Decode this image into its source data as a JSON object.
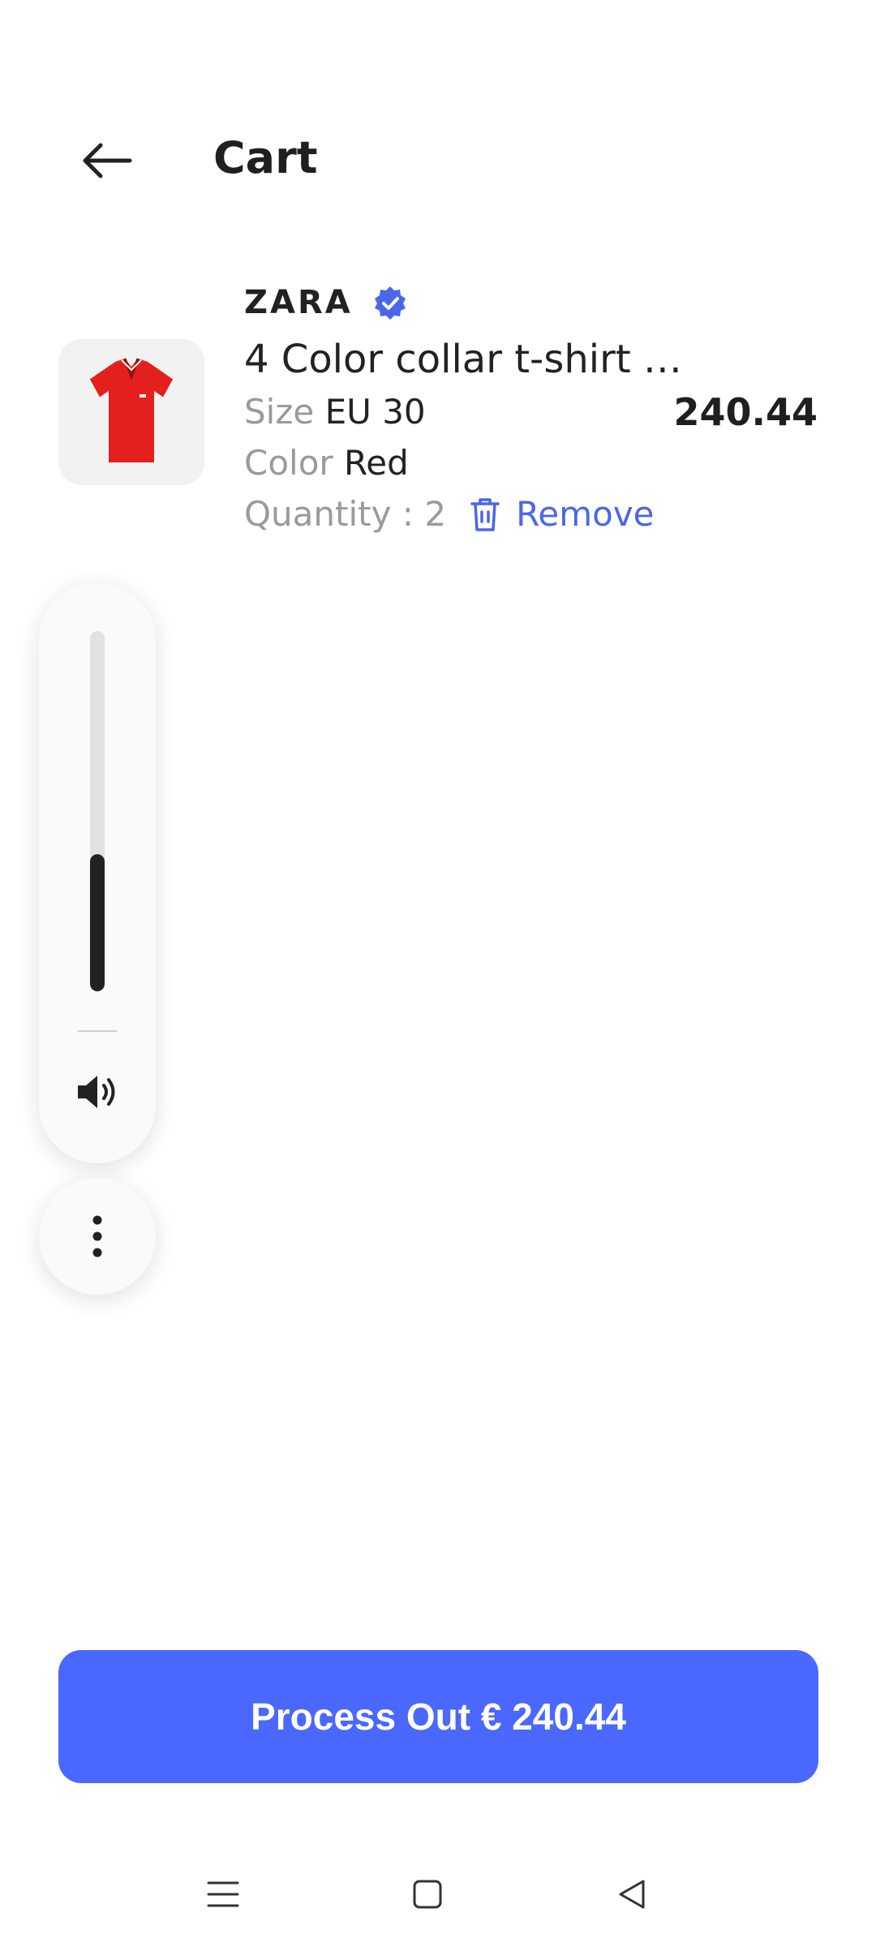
{
  "header": {
    "title": "Cart"
  },
  "cart_item": {
    "brand": "ZARA",
    "name": "4 Color collar t-shirt …",
    "size_label": "Size",
    "size_value": "EU 30",
    "color_label": "Color",
    "color_value": "Red",
    "quantity_text": "Quantity : 2",
    "remove_label": "Remove",
    "price": "240.44"
  },
  "volume": {
    "level_percent": 38
  },
  "checkout": {
    "label": "Process Out € 240.44"
  },
  "colors": {
    "accent": "#4a67fe",
    "link": "#4a67ea",
    "verified_badge": "#4a67ea",
    "product_red": "#e3201d"
  },
  "icons": [
    "back-arrow-icon",
    "verified-badge-icon",
    "trash-icon",
    "speaker-icon",
    "more-vertical-icon",
    "menu-icon",
    "home-square-icon",
    "back-triangle-icon"
  ]
}
